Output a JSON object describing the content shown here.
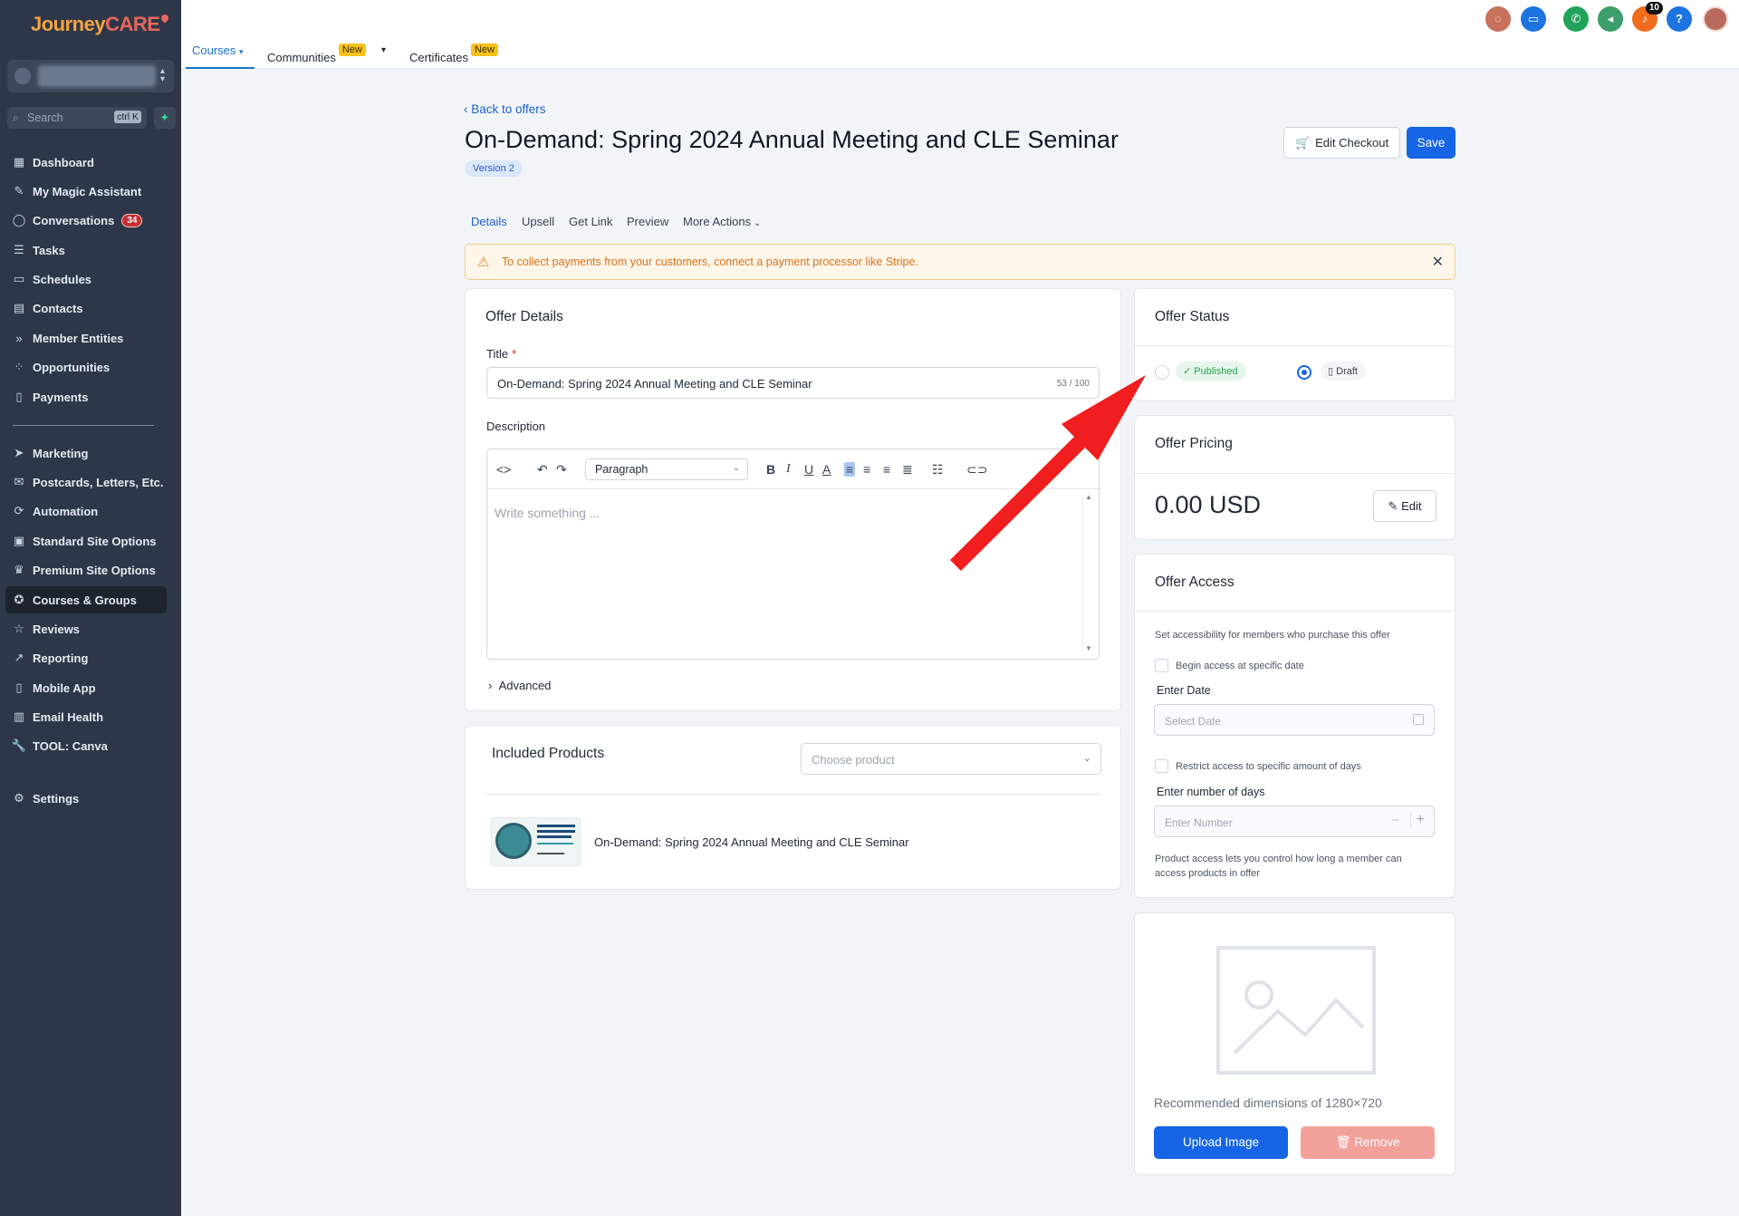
{
  "sidebar": {
    "logo": {
      "journey": "Journey",
      "care": "CARE"
    },
    "search": {
      "placeholder": "Search",
      "shortcut": "ctrl K"
    },
    "items": [
      {
        "label": "Dashboard",
        "icon": "dashboard-icon"
      },
      {
        "label": "My Magic Assistant",
        "icon": "magic-wand-icon"
      },
      {
        "label": "Conversations",
        "icon": "chat-icon",
        "badge": "34"
      },
      {
        "label": "Tasks",
        "icon": "tasks-icon"
      },
      {
        "label": "Schedules",
        "icon": "calendar-icon"
      },
      {
        "label": "Contacts",
        "icon": "contacts-icon"
      },
      {
        "label": "Member Entities",
        "icon": "chevrons-icon"
      },
      {
        "label": "Opportunities",
        "icon": "pipeline-icon"
      },
      {
        "label": "Payments",
        "icon": "receipt-icon"
      },
      {
        "label": "Marketing",
        "icon": "send-icon"
      },
      {
        "label": "Postcards, Letters, Etc.",
        "icon": "stamp-icon"
      },
      {
        "label": "Automation",
        "icon": "automation-icon"
      },
      {
        "label": "Standard Site Options",
        "icon": "site-icon"
      },
      {
        "label": "Premium Site Options",
        "icon": "premium-icon"
      },
      {
        "label": "Courses & Groups",
        "icon": "award-icon",
        "active": true
      },
      {
        "label": "Reviews",
        "icon": "star-icon"
      },
      {
        "label": "Reporting",
        "icon": "trend-icon"
      },
      {
        "label": "Mobile App",
        "icon": "mobile-icon"
      },
      {
        "label": "Email Health",
        "icon": "email-health-icon"
      },
      {
        "label": "TOOL: Canva",
        "icon": "wrench-icon"
      },
      {
        "label": "Settings",
        "icon": "gear-icon"
      }
    ]
  },
  "topbar": {
    "tabs": [
      {
        "label": "Courses",
        "active": true
      },
      {
        "label": "Communities",
        "badge": "New"
      },
      {
        "label": "Certificates",
        "badge": "New"
      }
    ],
    "icons": [
      {
        "name": "chat-bubble-icon",
        "color": "#c8715c"
      },
      {
        "name": "ticket-icon",
        "color": "#1d74e0"
      },
      {
        "name": "phone-icon",
        "color": "#22a35a"
      },
      {
        "name": "megaphone-icon",
        "color": "#3c9e6a"
      },
      {
        "name": "bell-icon",
        "color": "#f36b1c",
        "count": "10"
      },
      {
        "name": "help-icon",
        "color": "#1d74e0"
      },
      {
        "name": "avatar-icon",
        "color": "#b96a5e"
      }
    ]
  },
  "header": {
    "back": "Back to offers",
    "title": "On-Demand: Spring 2024 Annual Meeting and CLE Seminar",
    "version": "Version 2",
    "edit_checkout": "Edit Checkout",
    "save": "Save"
  },
  "subtabs": [
    "Details",
    "Upsell",
    "Get Link",
    "Preview",
    "More Actions"
  ],
  "alert": {
    "message": "To collect payments from your customers, connect a payment processor like Stripe."
  },
  "offer_details": {
    "heading": "Offer Details",
    "title_label": "Title",
    "title_value": "On-Demand: Spring 2024 Annual Meeting and CLE Seminar",
    "title_count": "53 / 100",
    "description_label": "Description",
    "paragraph_select": "Paragraph",
    "placeholder": "Write something ...",
    "advanced": "Advanced"
  },
  "included_products": {
    "heading": "Included Products",
    "choose_placeholder": "Choose product",
    "product_name": "On-Demand: Spring 2024 Annual Meeting and CLE Seminar"
  },
  "offer_status": {
    "heading": "Offer Status",
    "published": "Published",
    "draft": "Draft",
    "selected": "Draft"
  },
  "offer_pricing": {
    "heading": "Offer Pricing",
    "price": "0.00 USD",
    "edit": "Edit"
  },
  "offer_access": {
    "heading": "Offer Access",
    "description": "Set accessibility for members who purchase this offer",
    "begin_access": "Begin access at specific date",
    "enter_date_label": "Enter Date",
    "date_placeholder": "Select Date",
    "restrict_days": "Restrict access to specific amount of days",
    "days_label": "Enter number of days",
    "days_placeholder": "Enter Number",
    "note": "Product access lets you control how long a member can access products in offer"
  },
  "image_card": {
    "recommended": "Recommended dimensions of 1280×720",
    "upload": "Upload Image",
    "remove": "Remove"
  },
  "colors": {
    "primary": "#1565e6",
    "sidebar": "#2d3748",
    "arrow": "#f01e1e",
    "alert_text": "#d9731a"
  }
}
